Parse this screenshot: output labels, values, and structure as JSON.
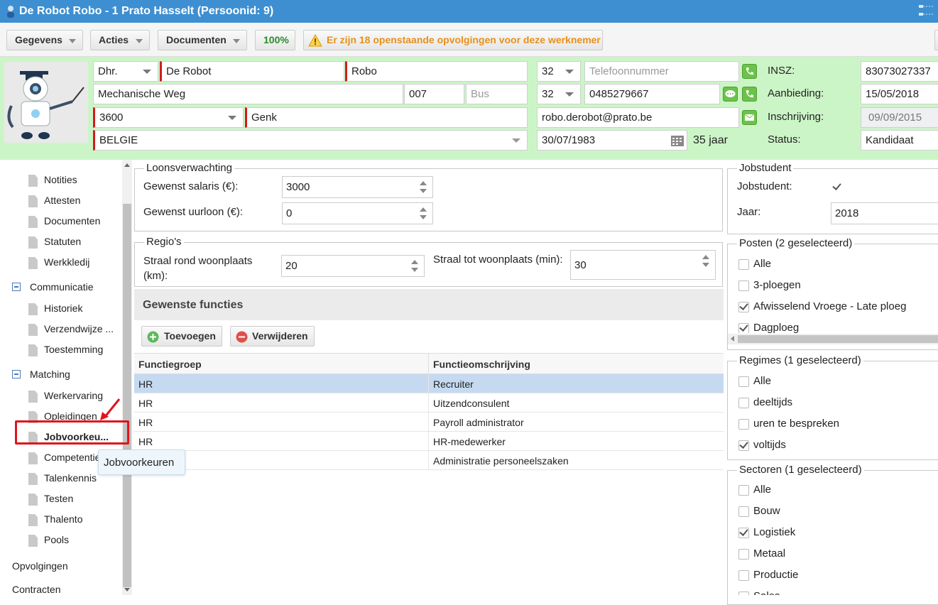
{
  "window": {
    "title": "De Robot Robo - 1 Prato Hasselt (Persoonid: 9)"
  },
  "toolbar": {
    "gegevens": "Gegevens",
    "acties": "Acties",
    "documenten": "Documenten",
    "progress": "100%",
    "alert": "Er zijn 18 openstaande opvolgingen voor deze werknemer"
  },
  "person": {
    "title": "Dhr.",
    "last_name": "De Robot",
    "first_name": "Robo",
    "street": "Mechanische Weg",
    "number": "007",
    "bus_placeholder": "Bus",
    "postcode": "3600",
    "city": "Genk",
    "country": "BELGIE",
    "phone_prefix_1": "32",
    "phone_placeholder": "Telefoonnummer",
    "phone_prefix_2": "32",
    "mobile": "0485279667",
    "email": "robo.derobot@prato.be",
    "birthdate": "30/07/1983",
    "age": "35 jaar",
    "insz_label": "INSZ:",
    "insz": "83073027337",
    "aanbieding_label": "Aanbieding:",
    "aanbieding": "15/05/2018",
    "inschrijving_label": "Inschrijving:",
    "inschrijving": "09/09/2015",
    "status_label": "Status:",
    "status": "Kandidaat"
  },
  "sidebar": {
    "items_top": [
      "Notities",
      "Attesten",
      "Documenten",
      "Statuten",
      "Werkkledij"
    ],
    "communicatie": "Communicatie",
    "communicatie_items": [
      "Historiek",
      "Verzendwijze ...",
      "Toestemming"
    ],
    "matching": "Matching",
    "matching_items": [
      "Werkervaring",
      "Opleidingen",
      "Jobvoorkeu...",
      "Competenties",
      "Talenkennis",
      "Testen",
      "Thalento",
      "Pools"
    ],
    "opvolgingen": "Opvolgingen",
    "contracten": "Contracten",
    "tooltip": "Jobvoorkeuren"
  },
  "loon": {
    "legend": "Loonsverwachting",
    "salaris_label": "Gewenst salaris (€):",
    "salaris": "3000",
    "uurloon_label": "Gewenst uurloon (€):",
    "uurloon": "0"
  },
  "regio": {
    "legend": "Regio's",
    "straal_km_label": "Straal rond woonplaats (km):",
    "straal_km": "20",
    "straal_min_label": "Straal tot woonplaats (min):",
    "straal_min": "30"
  },
  "functies": {
    "title": "Gewenste functies",
    "add": "Toevoegen",
    "remove": "Verwijderen",
    "col1": "Functiegroep",
    "col2": "Functieomschrijving",
    "rows": [
      {
        "groep": "HR",
        "omschrijving": "Recruiter"
      },
      {
        "groep": "HR",
        "omschrijving": "Uitzendconsulent"
      },
      {
        "groep": "HR",
        "omschrijving": "Payroll administrator"
      },
      {
        "groep": "HR",
        "omschrijving": "HR-medewerker"
      },
      {
        "groep": "",
        "omschrijving": "Administratie personeelszaken"
      }
    ]
  },
  "jobstudent": {
    "legend": "Jobstudent",
    "label": "Jobstudent:",
    "checked": true,
    "jaar_label": "Jaar:",
    "jaar": "2018"
  },
  "posten": {
    "legend": "Posten (2 geselecteerd)",
    "items": [
      "Alle",
      "3-ploegen",
      "Afwisselend Vroege - Late ploeg",
      "Dagploeg"
    ],
    "checked": [
      false,
      false,
      true,
      true
    ]
  },
  "regimes": {
    "legend": "Regimes (1 geselecteerd)",
    "items": [
      "Alle",
      "deeltijds",
      "uren te bespreken",
      "voltijds"
    ],
    "checked": [
      false,
      false,
      false,
      true
    ]
  },
  "sectoren": {
    "legend": "Sectoren (1 geselecteerd)",
    "items": [
      "Alle",
      "Bouw",
      "Logistiek",
      "Metaal",
      "Productie",
      "Sales"
    ],
    "checked": [
      false,
      false,
      true,
      false,
      false,
      false
    ]
  },
  "colors": {
    "titlebar": "#3d8fd1",
    "header_bg": "#ccf5c7",
    "selected_row": "#c5daf0",
    "annotation": "#e0141c",
    "alert": "#e8901a",
    "progress": "#2c8a2c"
  }
}
